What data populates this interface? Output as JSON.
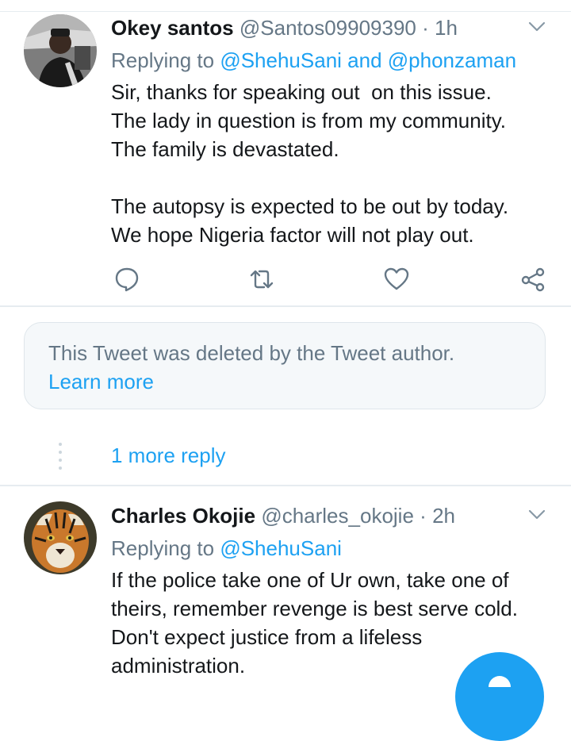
{
  "tweets": [
    {
      "name": "Okey santos",
      "handle": "@Santos09909390",
      "separator": "·",
      "time": "1h",
      "replying_prefix": "Replying to",
      "replying_mentions": "@ShehuSani and @phonzaman",
      "text": "Sir, thanks for speaking out  on this issue.\nThe lady in question is from my community.\nThe family is devastated.\n\nThe autopsy is expected to be out by today.\nWe hope Nigeria factor will not play out."
    },
    {
      "name": "Charles Okojie",
      "handle": "@charles_okojie",
      "separator": "·",
      "time": "2h",
      "replying_prefix": "Replying to",
      "replying_mentions": "@ShehuSani",
      "text": "If the police take one of Ur own, take one of\ntheirs, remember revenge is best serve cold.\nDon't expect justice from a lifeless\nadministration."
    }
  ],
  "deleted_notice": {
    "message": "This Tweet was deleted by the Tweet author.",
    "link": "Learn more"
  },
  "more_replies": "1 more reply",
  "icons": {
    "reply": "comment-icon",
    "retweet": "retweet-icon",
    "like": "heart-icon",
    "share": "share-icon",
    "menu": "chevron-down-icon",
    "compose": "compose-icon"
  },
  "colors": {
    "accent": "#1da1f2",
    "secondary_text": "#657786",
    "primary_text": "#14171a",
    "card_background": "#f5f8fa",
    "divider": "#e6ecf0"
  }
}
